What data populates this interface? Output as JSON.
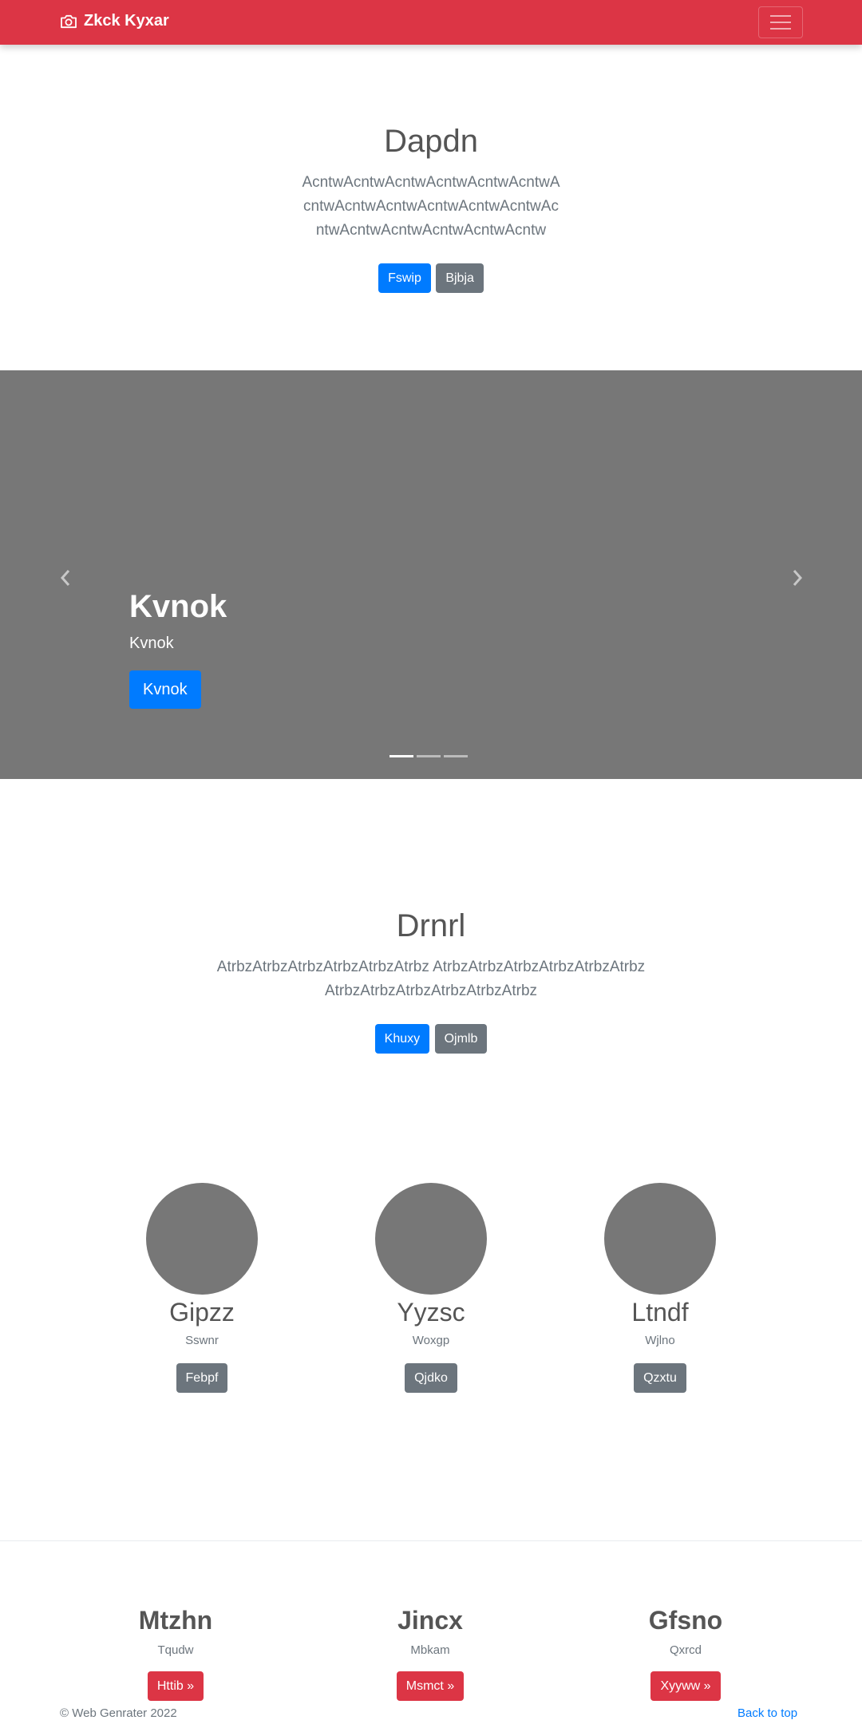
{
  "navbar": {
    "brand": "Zkck Kyxar",
    "brand_icon": "camera-icon",
    "toggler_icon": "hamburger-icon",
    "background": "#dc3545"
  },
  "hero1": {
    "title": "Dapdn",
    "text": "AcntwAcntwAcntwAcntwAcntwAcntwAcntwAcntwAcntwAcntwAcntwAcntwAcntwAcntwAcntwAcntwAcntwAcntw",
    "primary_button": "Fswip",
    "secondary_button": "Bjbja"
  },
  "carousel": {
    "title": "Kvnok",
    "subtitle": "Kvnok",
    "button": "Kvnok",
    "slide_count": 3,
    "active_slide": 1,
    "prev_icon": "chevron-left-icon",
    "next_icon": "chevron-right-icon"
  },
  "hero2": {
    "title": "Drnrl",
    "text": "AtrbzAtrbzAtrbzAtrbzAtrbzAtrbz AtrbzAtrbzAtrbzAtrbzAtrbzAtrbz AtrbzAtrbzAtrbzAtrbzAtrbzAtrbz",
    "primary_button": "Khuxy",
    "secondary_button": "Ojmlb"
  },
  "features": [
    {
      "title": "Gipzz",
      "subtitle": "Sswnr",
      "button": "Febpf"
    },
    {
      "title": "Yyzsc",
      "subtitle": "Woxgp",
      "button": "Qjdko"
    },
    {
      "title": "Ltndf",
      "subtitle": "Wjlno",
      "button": "Qzxtu"
    }
  ],
  "bottom": [
    {
      "title": "Mtzhn",
      "subtitle": "Tqudw",
      "button": "Httib »"
    },
    {
      "title": "Jincx",
      "subtitle": "Mbkam",
      "button": "Msmct »"
    },
    {
      "title": "Gfsno",
      "subtitle": "Qxrcd",
      "button": "Xyyww »"
    }
  ],
  "footer": {
    "copyright": "© Web Genrater 2022",
    "back_to_top": "Back to top"
  }
}
